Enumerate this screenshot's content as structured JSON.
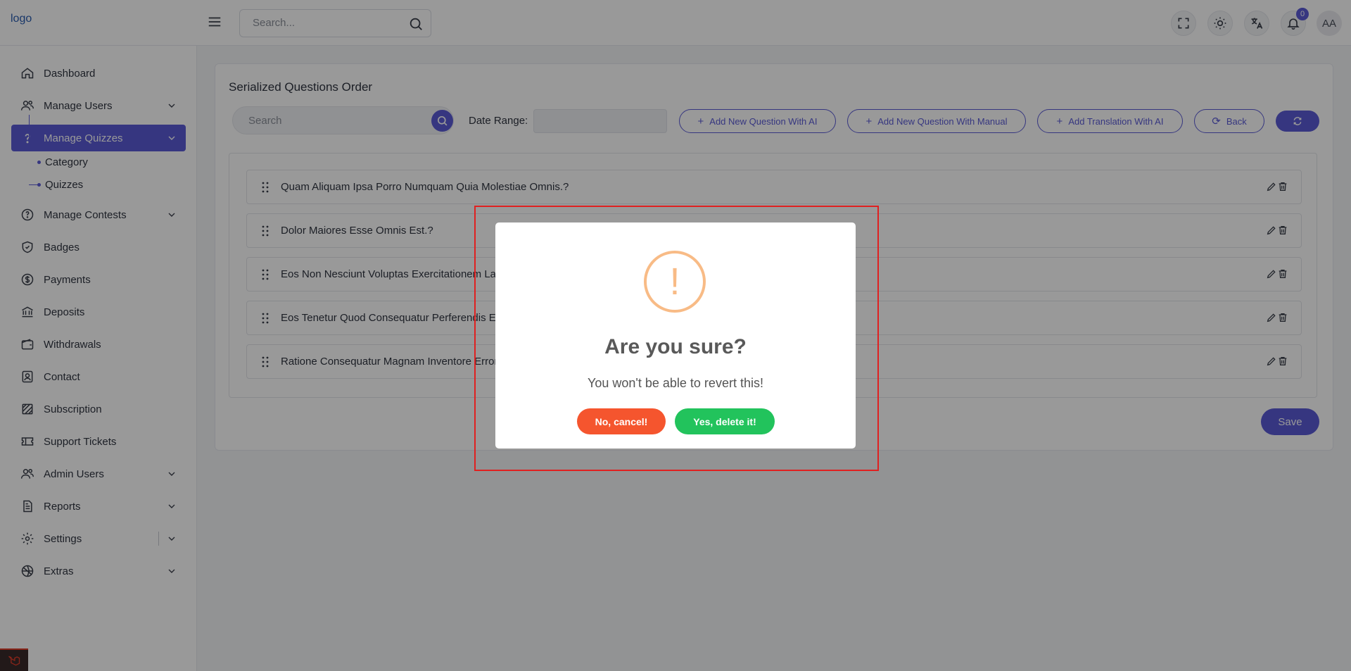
{
  "header": {
    "logo_alt": "logo",
    "search_placeholder": "Search...",
    "notification_count": "0",
    "avatar_initials": "AA"
  },
  "sidebar": {
    "items": [
      {
        "label": "Dashboard",
        "icon": "home-icon",
        "has_chevron": false
      },
      {
        "label": "Manage Users",
        "icon": "users-icon",
        "has_chevron": true
      },
      {
        "label": "Manage Quizzes",
        "icon": "question-icon",
        "has_chevron": true,
        "active": true
      },
      {
        "label": "Manage Contests",
        "icon": "contest-icon",
        "has_chevron": true
      },
      {
        "label": "Badges",
        "icon": "badge-icon",
        "has_chevron": false
      },
      {
        "label": "Payments",
        "icon": "dollar-icon",
        "has_chevron": false
      },
      {
        "label": "Deposits",
        "icon": "bank-icon",
        "has_chevron": false
      },
      {
        "label": "Withdrawals",
        "icon": "wallet-icon",
        "has_chevron": false
      },
      {
        "label": "Contact",
        "icon": "contact-icon",
        "has_chevron": false
      },
      {
        "label": "Subscription",
        "icon": "subscription-icon",
        "has_chevron": false
      },
      {
        "label": "Support Tickets",
        "icon": "ticket-icon",
        "has_chevron": false
      },
      {
        "label": "Admin Users",
        "icon": "admin-users-icon",
        "has_chevron": true
      },
      {
        "label": "Reports",
        "icon": "reports-icon",
        "has_chevron": true
      },
      {
        "label": "Settings",
        "icon": "gear-icon",
        "has_chevron": true
      },
      {
        "label": "Extras",
        "icon": "extras-icon",
        "has_chevron": true
      }
    ],
    "sub_items": [
      "Category",
      "Quizzes"
    ]
  },
  "main": {
    "title": "Serialized Questions Order",
    "search_placeholder": "Search",
    "date_range_label": "Date Range:",
    "buttons": {
      "add_ai": "Add New Question With AI",
      "add_manual": "Add New Question With Manual",
      "add_translation": "Add Translation With AI",
      "back": "Back",
      "save": "Save"
    },
    "questions": [
      "Quam Aliquam Ipsa Porro Numquam Quia Molestiae Omnis.?",
      "Dolor Maiores Esse Omnis Est.?",
      "Eos Non Nesciunt Voluptas Exercitationem Lab",
      "Eos Tenetur Quod Consequatur Perferendis Ea",
      "Ratione Consequatur Magnam Inventore Error"
    ]
  },
  "modal": {
    "icon_glyph": "!",
    "title": "Are you sure?",
    "text": "You won't be able to revert this!",
    "cancel_label": "No, cancel!",
    "confirm_label": "Yes, delete it!"
  },
  "colors": {
    "accent": "#5b5bd6",
    "warning": "#f8bb86",
    "cancel": "#f5552e",
    "confirm": "#22c35c",
    "highlight": "#e02020"
  }
}
